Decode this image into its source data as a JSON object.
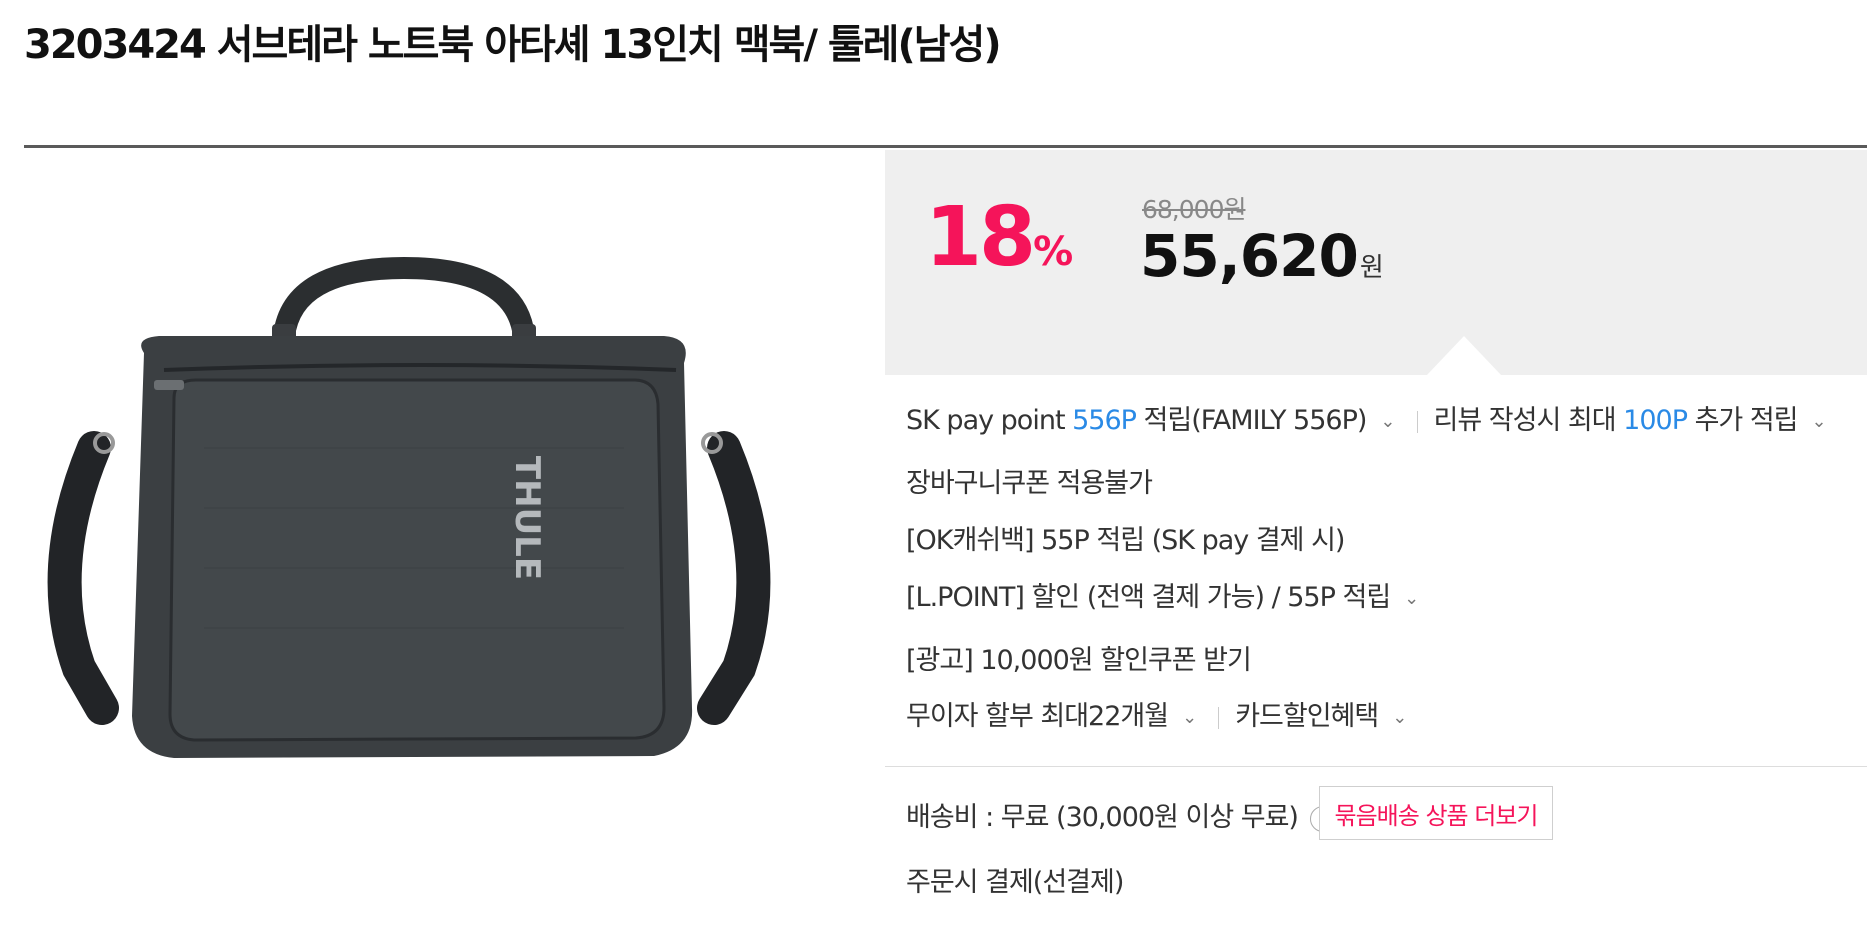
{
  "product": {
    "title": "3203424 서브테라 노트북 아타셰 13인치 맥북/ 툴레(남성)"
  },
  "image": {
    "brand_text": "THULE"
  },
  "price": {
    "discount_number": "18",
    "discount_unit": "%",
    "original": "68,000원",
    "sale": "55,620",
    "sale_unit": "원"
  },
  "benefits": {
    "sk_pay_prefix": "SK pay point ",
    "sk_pay_points": "556P",
    "sk_pay_suffix": " 적립(FAMILY 556P)",
    "review_prefix": "리뷰 작성시 최대 ",
    "review_points": "100P",
    "review_suffix": " 추가 적립",
    "cart_coupon": "장바구니쿠폰 적용불가",
    "okcashbag": "[OK캐쉬백] 55P 적립 (SK pay 결제 시)",
    "lpoint": "[L.POINT] 할인 (전액 결제 가능) / 55P 적립",
    "ad_coupon": "[광고] 10,000원 할인쿠폰 받기",
    "installment": "무이자 할부 최대22개월",
    "card_discount": "카드할인혜택"
  },
  "shipping": {
    "fee": "배송비 : 무료 (30,000원 이상 무료)",
    "help_icon": "?",
    "bundle_button": "묶음배송 상품 더보기",
    "payment": "주문시 결제(선결제)"
  },
  "icons": {
    "chevron": "⌄"
  },
  "colors": {
    "accent_pink": "#f5145a",
    "point_blue": "#2a8ae6",
    "price_box_bg": "#efefef"
  }
}
